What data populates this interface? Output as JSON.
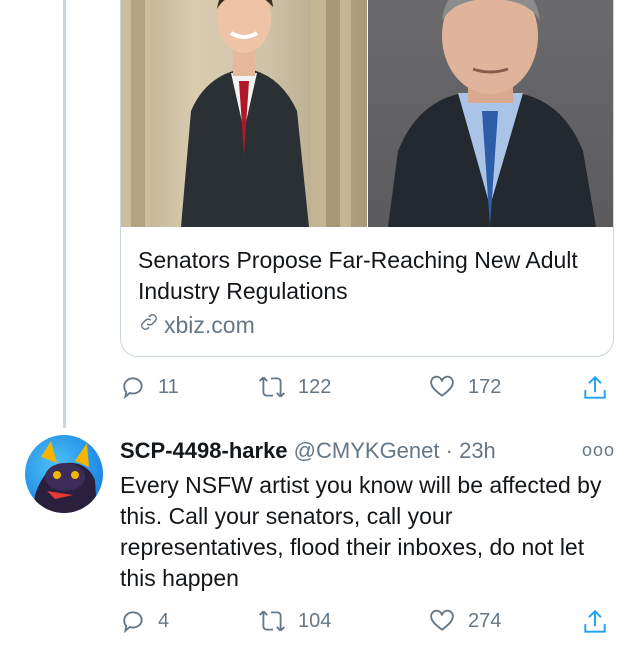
{
  "link_card": {
    "title": "Senators Propose Far-Reaching New Adult Industry Regulations",
    "domain": "xbiz.com"
  },
  "quoted_tweet_actions": {
    "reply_count": "11",
    "retweet_count": "122",
    "like_count": "172"
  },
  "reply_tweet": {
    "display_name": "SCP-4498-harke",
    "handle": "@CMYKGenet",
    "separator": "·",
    "time": "23h",
    "more_icon": "ooo",
    "text": "Every NSFW artist you know will be affected by this. Call your senators, call your representatives, flood their inboxes, do not let this happen",
    "actions": {
      "reply_count": "4",
      "retweet_count": "104",
      "like_count": "274"
    }
  },
  "colors": {
    "text": "#14171a",
    "muted": "#657786",
    "border": "#ccd6dd"
  },
  "icons": [
    "reply-icon",
    "retweet-icon",
    "like-icon",
    "share-icon",
    "link-icon",
    "more-icon"
  ]
}
